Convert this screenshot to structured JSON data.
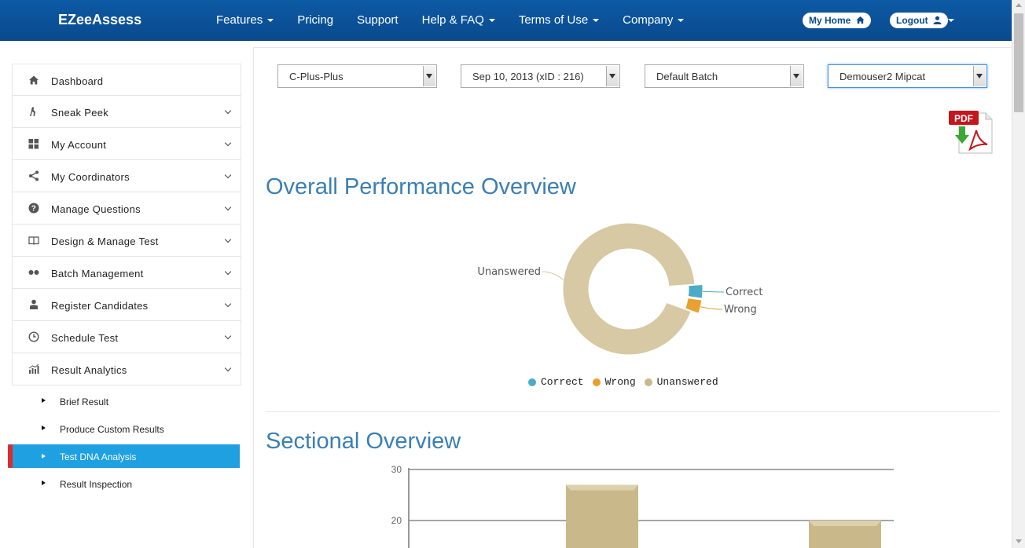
{
  "brand": "EZeeAssess",
  "nav": {
    "items": [
      {
        "label": "Features",
        "dropdown": true
      },
      {
        "label": "Pricing",
        "dropdown": false
      },
      {
        "label": "Support",
        "dropdown": false
      },
      {
        "label": "Help & FAQ",
        "dropdown": true
      },
      {
        "label": "Terms of Use",
        "dropdown": true
      },
      {
        "label": "Company",
        "dropdown": true
      }
    ],
    "my_home": "My Home",
    "logout": "Logout"
  },
  "sidebar": {
    "items": [
      {
        "label": "Dashboard",
        "icon": "home-icon",
        "expandable": false
      },
      {
        "label": "Sneak Peek",
        "icon": "sneak-peek-icon",
        "expandable": true
      },
      {
        "label": "My Account",
        "icon": "grid-icon",
        "expandable": true
      },
      {
        "label": "My Coordinators",
        "icon": "share-icon",
        "expandable": true
      },
      {
        "label": "Manage Questions",
        "icon": "question-icon",
        "expandable": true
      },
      {
        "label": "Design & Manage Test",
        "icon": "book-icon",
        "expandable": true
      },
      {
        "label": "Batch Management",
        "icon": "dots-icon",
        "expandable": true
      },
      {
        "label": "Register Candidates",
        "icon": "user-icon",
        "expandable": true
      },
      {
        "label": "Schedule Test",
        "icon": "clock-icon",
        "expandable": true
      },
      {
        "label": "Result Analytics",
        "icon": "bar-chart-icon",
        "expandable": true
      }
    ],
    "submenu": [
      {
        "label": "Brief Result",
        "active": false
      },
      {
        "label": "Produce Custom Results",
        "active": false
      },
      {
        "label": "Test DNA Analysis",
        "active": true
      },
      {
        "label": "Result Inspection",
        "active": false
      }
    ]
  },
  "filters": {
    "test": "C-Plus-Plus",
    "date": "Sep 10, 2013 (xID : 216)",
    "batch": "Default Batch",
    "candidate": "Demouser2 Mipcat"
  },
  "pdf_label": "PDF",
  "sections": {
    "overall_title": "Overall Performance Overview",
    "sectional_title": "Sectional Overview"
  },
  "colors": {
    "correct": "#4bacc6",
    "wrong": "#e8a030",
    "unanswered": "#d6c9a3",
    "bar": "#c9b98a",
    "accent": "#1ea0e1",
    "title": "#3a7fb5"
  },
  "chart_data": [
    {
      "type": "pie",
      "variant": "donut",
      "categories": [
        "Correct",
        "Wrong",
        "Unanswered"
      ],
      "values": [
        1,
        1,
        28
      ],
      "legend": "bottom",
      "labels": [
        "Correct",
        "Wrong",
        "Unanswered"
      ]
    },
    {
      "type": "bar",
      "categories": [
        "",
        ""
      ],
      "values": [
        27,
        20
      ],
      "ylim": [
        0,
        30
      ],
      "yticks": [
        20,
        30
      ],
      "grid": true
    }
  ]
}
